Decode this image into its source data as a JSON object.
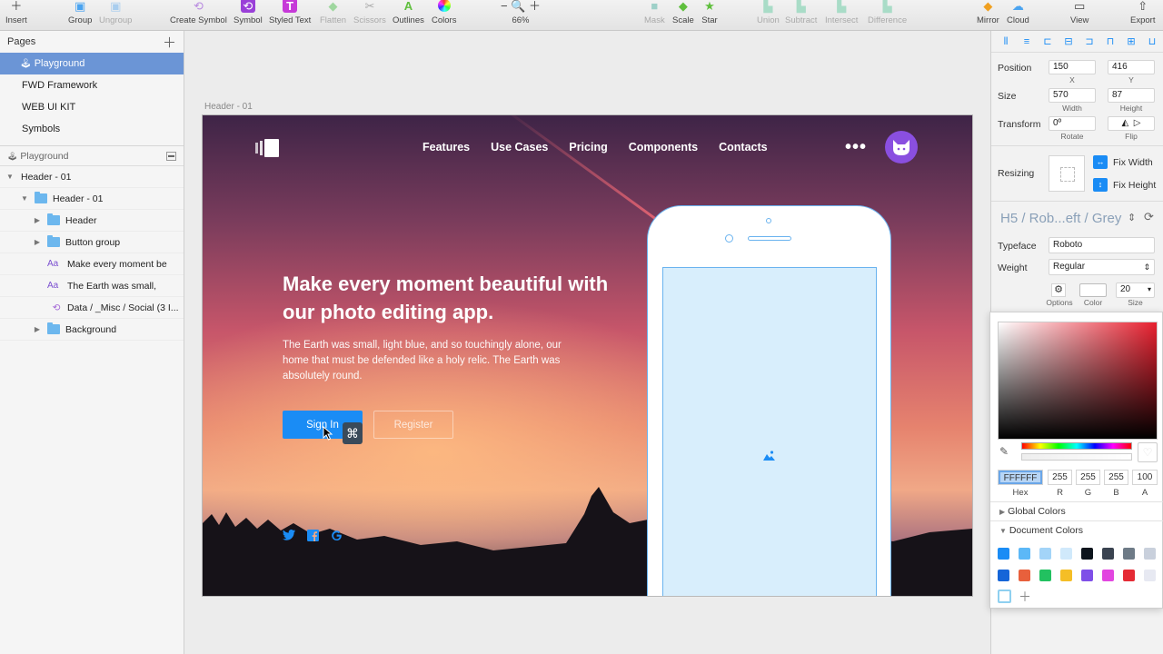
{
  "toolbar": {
    "insert": "Insert",
    "group": "Group",
    "ungroup": "Ungroup",
    "create_symbol": "Create Symbol",
    "symbol": "Symbol",
    "styled_text": "Styled Text",
    "flatten": "Flatten",
    "scissors": "Scissors",
    "outlines": "Outlines",
    "colors": "Colors",
    "zoom": "66%",
    "mask": "Mask",
    "scale": "Scale",
    "star": "Star",
    "union": "Union",
    "subtract": "Subtract",
    "intersect": "Intersect",
    "difference": "Difference",
    "mirror": "Mirror",
    "cloud": "Cloud",
    "view": "View",
    "export": "Export"
  },
  "pages": {
    "title": "Pages",
    "items": [
      "Playground",
      "FWD Framework",
      "WEB UI KIT",
      "Symbols"
    ]
  },
  "layers": {
    "page_name": "Playground",
    "items": [
      "Header - 01",
      "Header - 01",
      "Header",
      "Button group",
      "Make every moment be",
      "The Earth was small,",
      "Data / _Misc / Social (3 I...",
      "Background"
    ]
  },
  "artboard": {
    "label": "Header - 01",
    "nav": [
      "Features",
      "Use Cases",
      "Pricing",
      "Components",
      "Contacts"
    ],
    "hero_title": "Make every moment beautiful with our photo editing app.",
    "hero_subtitle": "The Earth was small, light blue, and so touchingly alone, our home that must be defended like a holy relic. The Earth was absolutely round.",
    "sign_in": "Sign In",
    "register": "Register",
    "cmd_glyph": "⌘"
  },
  "inspector": {
    "position_label": "Position",
    "x": "150",
    "y": "416",
    "x_label": "X",
    "y_label": "Y",
    "size_label": "Size",
    "width": "570",
    "height": "87",
    "width_label": "Width",
    "height_label": "Height",
    "transform_label": "Transform",
    "rotate": "0º",
    "rotate_label": "Rotate",
    "flip_label": "Flip",
    "resizing_label": "Resizing",
    "fix_width": "Fix Width",
    "fix_height": "Fix Height",
    "text_style": "H5 / Rob...eft / Grey",
    "typeface_label": "Typeface",
    "typeface": "Roboto",
    "weight_label": "Weight",
    "weight": "Regular",
    "options_label": "Options",
    "color_label": "Color",
    "size2_label": "Size",
    "font_size": "20"
  },
  "color_picker": {
    "hex": "FFFFFF",
    "r": "255",
    "g": "255",
    "b": "255",
    "a": "100",
    "hex_label": "Hex",
    "r_label": "R",
    "g_label": "G",
    "b_label": "B",
    "a_label": "A",
    "global_colors": "Global Colors",
    "document_colors": "Document Colors",
    "swatches": [
      "#1a8cf5",
      "#5cb8f7",
      "#a3d4f8",
      "#d0e9fb",
      "#0d141c",
      "#3a4350",
      "#6e7b87",
      "#c9d0dc",
      "#1565d8",
      "#e8603c",
      "#22c160",
      "#f5be26",
      "#7f4fe8",
      "#e246e0",
      "#e52b35",
      "#e7e9f2"
    ]
  }
}
